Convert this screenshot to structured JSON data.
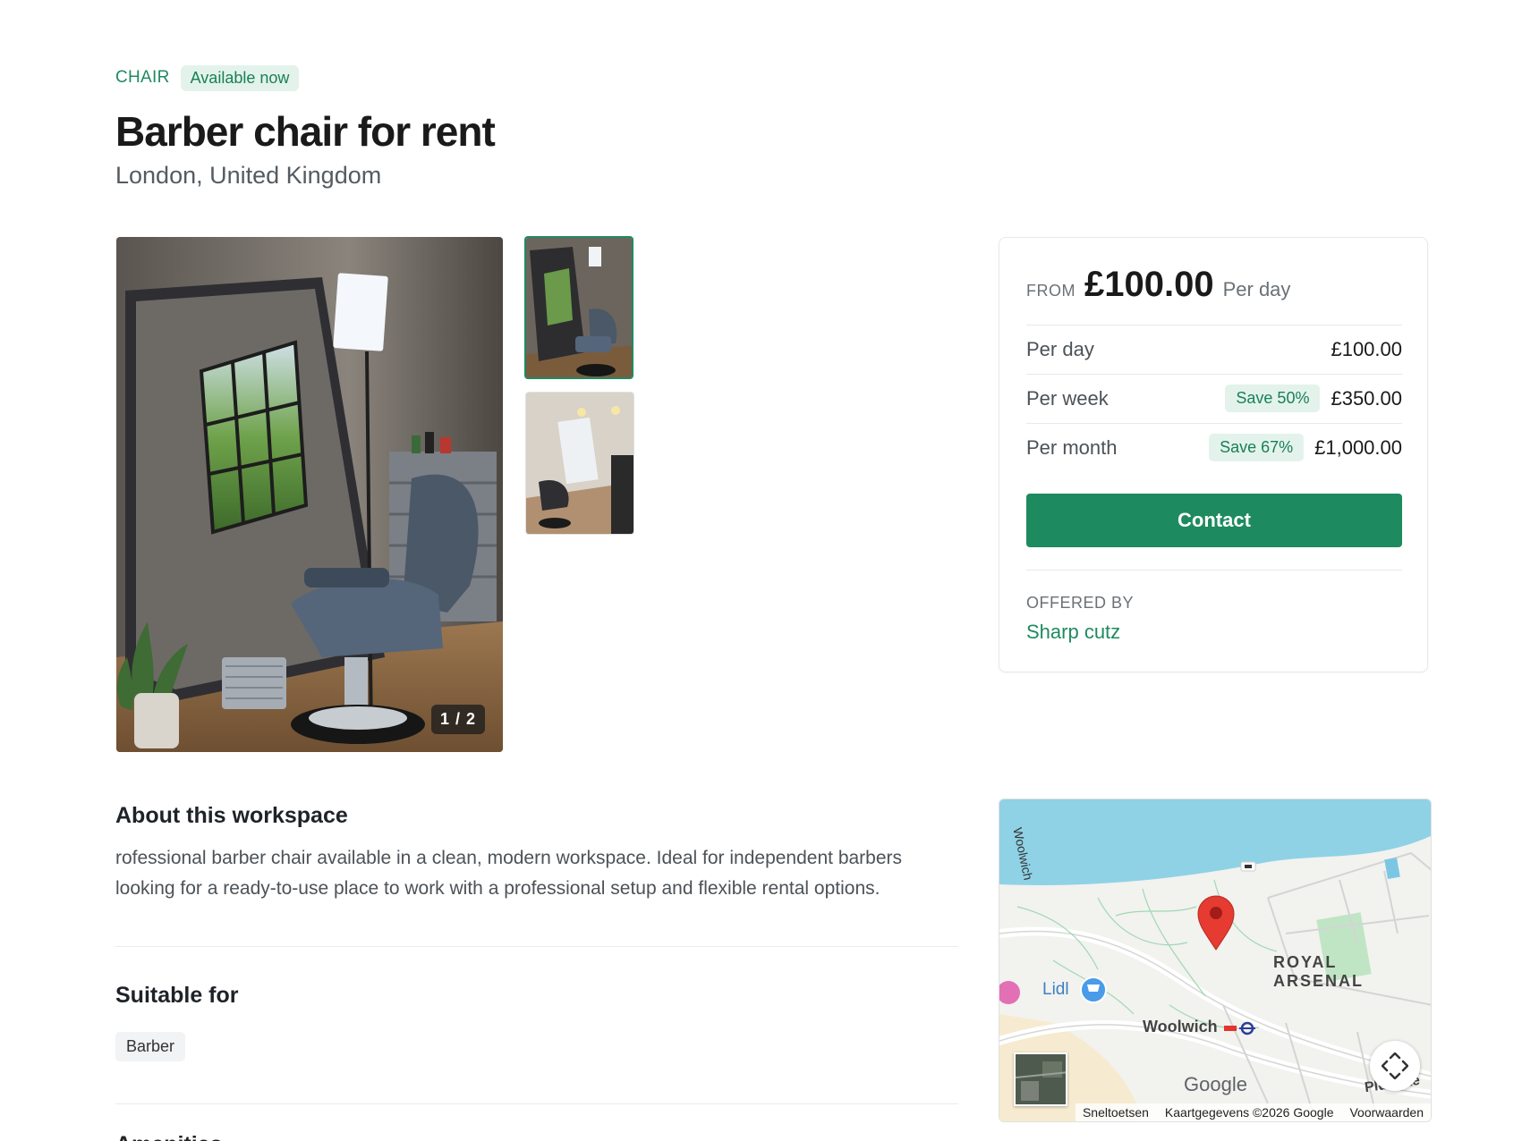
{
  "listing": {
    "category": "CHAIR",
    "availability": "Available now",
    "title": "Barber chair for rent",
    "location": "London, United Kingdom"
  },
  "gallery": {
    "counter": "1 / 2"
  },
  "pricing": {
    "from_label": "FROM",
    "from_price": "£100.00",
    "from_unit": "Per day",
    "rates": [
      {
        "label": "Per day",
        "badge": "",
        "price": "£100.00"
      },
      {
        "label": "Per week",
        "badge": "Save 50%",
        "price": "£350.00"
      },
      {
        "label": "Per month",
        "badge": "Save 67%",
        "price": "£1,000.00"
      }
    ],
    "contact_label": "Contact",
    "offered_by_label": "OFFERED BY",
    "offered_by_name": "Sharp cutz"
  },
  "about": {
    "heading": "About this workspace",
    "text": "rofessional barber chair available in a clean, modern workspace. Ideal for independent barbers looking for a ready-to-use place to work with a professional setup and flexible rental options."
  },
  "suitable": {
    "heading": "Suitable for",
    "items": [
      "Barber"
    ]
  },
  "amenities": {
    "heading": "Amenities"
  },
  "map": {
    "labels": {
      "woolwich_road": "Woolwich",
      "royal_arsenal": "ROYAL ARSENAL",
      "lidl": "Lidl",
      "woolwich_station": "Woolwich",
      "plumstead": "Plumste"
    },
    "google": "Google",
    "footer": [
      "Sneltoetsen",
      "Kaartgegevens ©2026 Google",
      "Voorwaarden"
    ]
  },
  "colors": {
    "accent": "#1e8a5f",
    "badge_bg": "#e3f3ec",
    "water": "#8fd2e6",
    "map_land": "#f4f3ef"
  }
}
